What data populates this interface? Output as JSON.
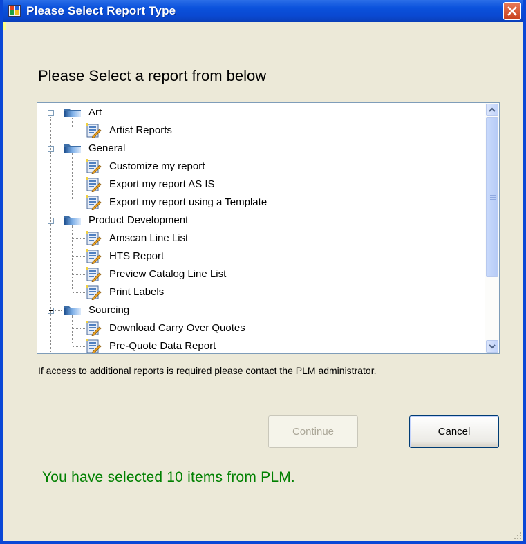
{
  "window": {
    "title": "Please Select Report Type",
    "icons": {
      "app": "app-window-icon",
      "close": "close-icon"
    }
  },
  "main": {
    "heading": "Please Select a report from below",
    "tree": {
      "groups": [
        {
          "label": "Art",
          "icon": "folder-icon",
          "items": [
            {
              "label": "Artist Reports",
              "icon": "report-icon"
            }
          ]
        },
        {
          "label": "General",
          "icon": "folder-icon",
          "items": [
            {
              "label": "Customize my report",
              "icon": "report-icon"
            },
            {
              "label": "Export my report AS IS",
              "icon": "report-icon"
            },
            {
              "label": "Export my report using a Template",
              "icon": "report-icon"
            }
          ]
        },
        {
          "label": "Product Development",
          "icon": "folder-icon",
          "items": [
            {
              "label": "Amscan Line List",
              "icon": "report-icon"
            },
            {
              "label": "HTS Report",
              "icon": "report-icon"
            },
            {
              "label": "Preview Catalog Line List",
              "icon": "report-icon"
            },
            {
              "label": "Print Labels",
              "icon": "report-icon"
            }
          ]
        },
        {
          "label": "Sourcing",
          "icon": "folder-icon",
          "items": [
            {
              "label": "Download Carry Over Quotes",
              "icon": "report-icon"
            },
            {
              "label": "Pre-Quote Data Report",
              "icon": "report-icon"
            }
          ]
        }
      ]
    },
    "info_text": "If access to additional reports is required please contact the PLM administrator.",
    "buttons": {
      "continue": "Continue",
      "cancel": "Cancel"
    },
    "status_text": "You have selected 10 items from PLM."
  },
  "colors": {
    "title_bar": "#0a49d2",
    "dialog_bg": "#ece9d8",
    "status_text": "#008000",
    "close_button": "#d85a34"
  }
}
